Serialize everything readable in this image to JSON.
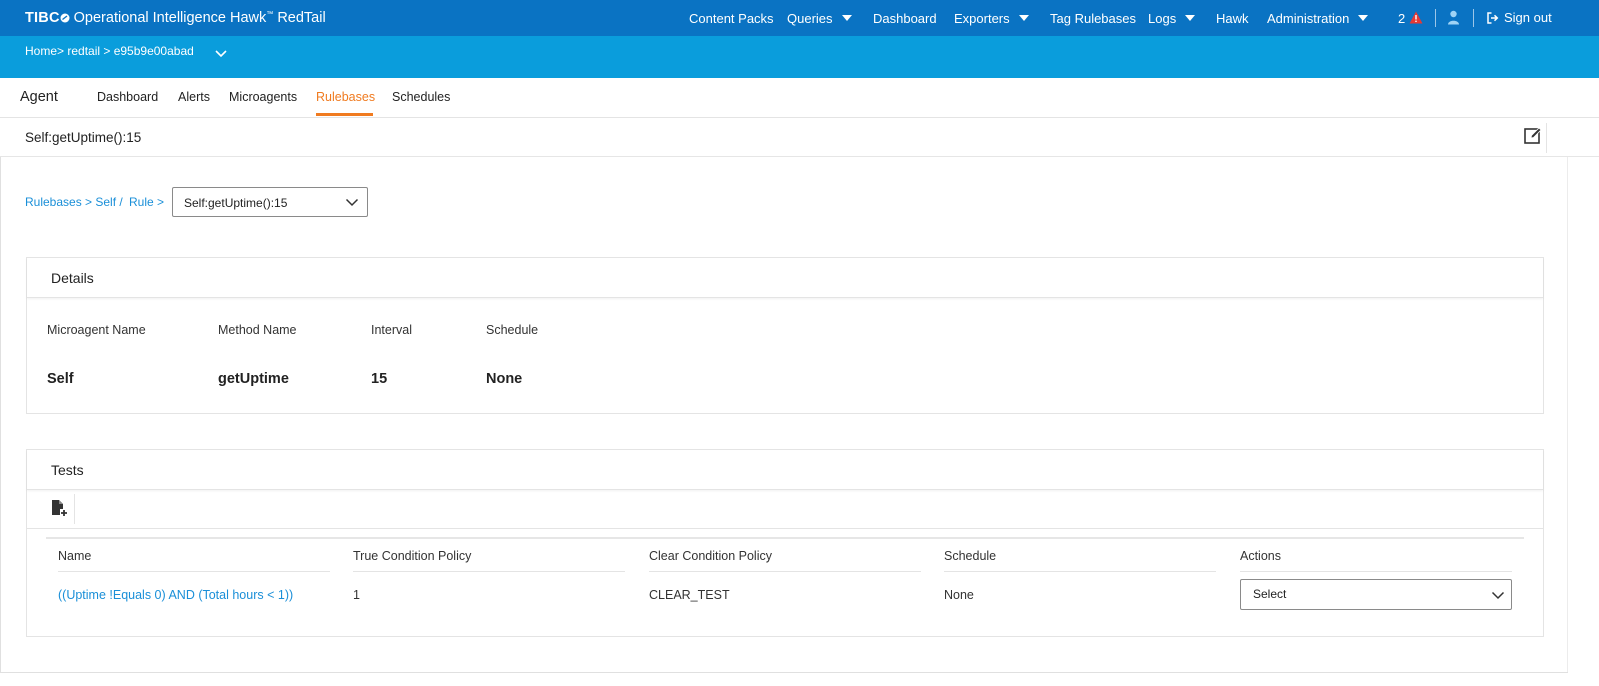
{
  "header": {
    "brand_tibco": "TIBC",
    "brand_name": "Operational Intelligence Hawk",
    "brand_suffix": "RedTail",
    "nav": {
      "content_packs": "Content Packs",
      "queries": "Queries",
      "dashboard": "Dashboard",
      "exporters": "Exporters",
      "tag_rulebases": "Tag Rulebases",
      "logs": "Logs",
      "hawk": "Hawk",
      "administration": "Administration"
    },
    "alert_count": "2",
    "sign_out": "Sign out"
  },
  "breadcrumb": {
    "text": "Home> redtail > e95b9e00abad"
  },
  "tabs": {
    "title": "Agent",
    "items": [
      "Dashboard",
      "Alerts",
      "Microagents",
      "Rulebases",
      "Schedules"
    ],
    "active": "Rulebases"
  },
  "page": {
    "title": "Self:getUptime():15"
  },
  "rule_breadcrumb": {
    "rulebases": "Rulebases > Self /",
    "rule": "Rule >",
    "selected_rule": "Self:getUptime():15"
  },
  "details": {
    "heading": "Details",
    "labels": {
      "microagent": "Microagent Name",
      "method": "Method Name",
      "interval": "Interval",
      "schedule": "Schedule"
    },
    "values": {
      "microagent": "Self",
      "method": "getUptime",
      "interval": "15",
      "schedule": "None"
    }
  },
  "tests": {
    "heading": "Tests",
    "columns": [
      "Name",
      "True Condition Policy",
      "Clear Condition Policy",
      "Schedule",
      "Actions"
    ],
    "rows": [
      {
        "name": "((Uptime !Equals 0) AND (Total hours < 1))",
        "true_policy": "1",
        "clear_policy": "CLEAR_TEST",
        "schedule": "None",
        "action": "Select"
      }
    ]
  },
  "colors": {
    "topbar": "#0a73c3",
    "crumbband": "#0a9ddc",
    "accent": "#f07b20",
    "link": "#1a8fd8",
    "alert": "#e53935"
  }
}
